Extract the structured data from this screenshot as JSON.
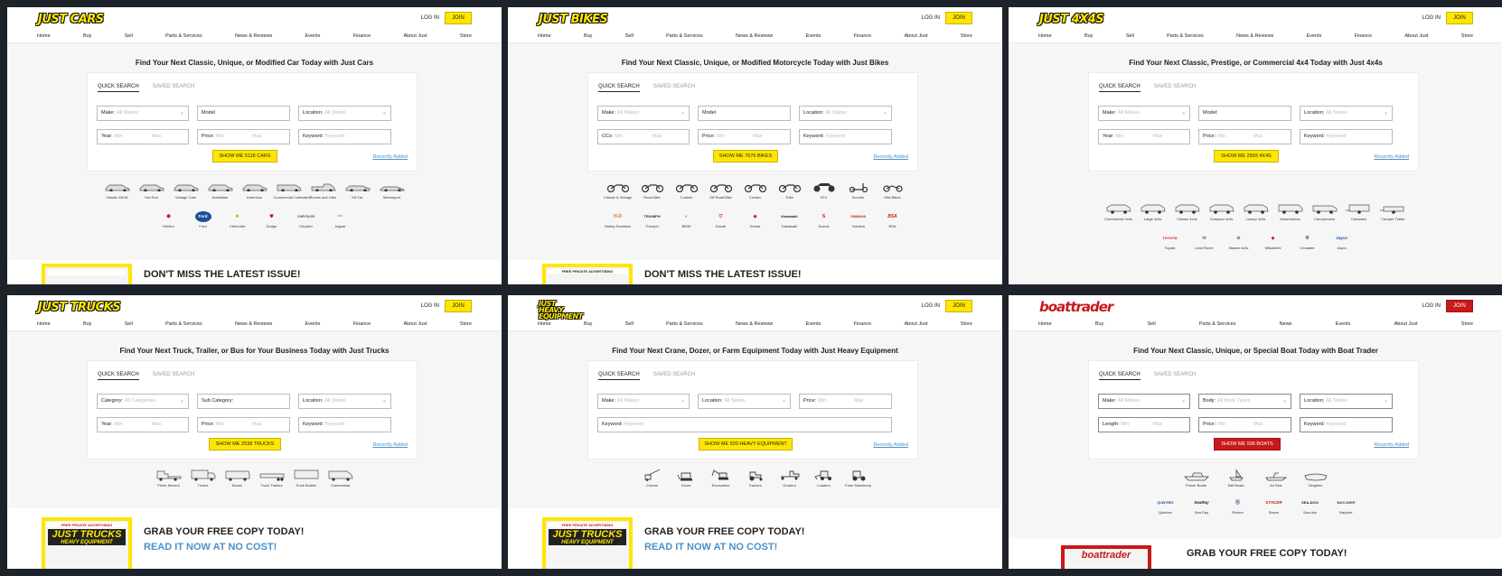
{
  "panels": [
    {
      "logo": "JUST CARS",
      "login": "LOG IN",
      "join": "JOIN",
      "nav": [
        "Home",
        "Buy",
        "Sell",
        "Parts & Services",
        "News & Reviews",
        "Events",
        "Finance",
        "About Just",
        "Store"
      ],
      "headline": "Find Your Next Classic, Unique, or Modified Car Today with Just Cars",
      "tabs": [
        "QUICK SEARCH",
        "SAVED SEARCH"
      ],
      "row1": [
        {
          "label": "Make:",
          "placeholder": "All Makes"
        },
        {
          "label": "Model",
          "placeholder": ""
        },
        {
          "label": "Location:",
          "placeholder": "All States"
        }
      ],
      "row2": [
        {
          "label": "Year:",
          "min": "Min",
          "max": "Max"
        },
        {
          "label": "Price:",
          "min": "Min",
          "max": "Max"
        },
        {
          "label": "Keyword:",
          "placeholder": "Keyword"
        }
      ],
      "cta": "SHOW ME 5118 CARS",
      "recent": "Recently Added",
      "categories": [
        "Classic 48-96",
        "Hot Rod",
        "Vintage Cars",
        "Australian",
        "American",
        "Commercial Collectable",
        "Trucks and Utes",
        "Kit Car",
        "Motorsport"
      ],
      "brands": [
        {
          "name": "Holden",
          "mark": "⬢"
        },
        {
          "name": "Ford",
          "mark": "Ford"
        },
        {
          "name": "Chevrolet",
          "mark": "✚"
        },
        {
          "name": "Dodge",
          "mark": "⛊"
        },
        {
          "name": "Chrysler",
          "mark": "CHRYSLER"
        },
        {
          "name": "Jaguar",
          "mark": "〰"
        }
      ],
      "promo_title": "DON'T MISS THE LATEST ISSUE!"
    },
    {
      "logo": "JUST BIKES",
      "login": "LOG IN",
      "join": "JOIN",
      "nav": [
        "Home",
        "Buy",
        "Sell",
        "Parts & Services",
        "News & Reviews",
        "Events",
        "Finance",
        "About Just",
        "Store"
      ],
      "headline": "Find Your Next Classic, Unique, or Modified Motorcycle Today with Just Bikes",
      "tabs": [
        "QUICK SEARCH",
        "SAVED SEARCH"
      ],
      "row1": [
        {
          "label": "Make:",
          "placeholder": "All Makes"
        },
        {
          "label": "Model",
          "placeholder": ""
        },
        {
          "label": "Location:",
          "placeholder": "All States"
        }
      ],
      "row2": [
        {
          "label": "CCs:",
          "min": "Min",
          "max": "Max"
        },
        {
          "label": "Price:",
          "min": "Min",
          "max": "Max"
        },
        {
          "label": "Keyword:",
          "placeholder": "Keyword"
        }
      ],
      "cta": "SHOW ME 7076 BIKES",
      "recent": "Recently Added",
      "categories": [
        "Classic & Vintage",
        "Road Bike",
        "Custom",
        "Off Road Bike",
        "Cruiser",
        "Trike",
        "ATV",
        "Scooter",
        "Mini Bikes"
      ],
      "brands": [
        {
          "name": "Harley-Davidson",
          "mark": "H-D"
        },
        {
          "name": "Triumph",
          "mark": "TRIUMPH"
        },
        {
          "name": "BMW",
          "mark": "◐"
        },
        {
          "name": "Ducati",
          "mark": "⛉"
        },
        {
          "name": "Honda",
          "mark": "◆"
        },
        {
          "name": "Kawasaki",
          "mark": "Kawasaki"
        },
        {
          "name": "Suzuki",
          "mark": "S"
        },
        {
          "name": "Yamaha",
          "mark": "YAMAHA"
        },
        {
          "name": "BSA",
          "mark": "BSA"
        }
      ],
      "promo_title": "DON'T MISS THE LATEST ISSUE!",
      "mag_banner": "FREE PRIVATE ADVERTISING"
    },
    {
      "logo": "JUST 4X4S",
      "login": "LOG IN",
      "join": "JOIN",
      "nav": [
        "Home",
        "Buy",
        "Sell",
        "Parts & Services",
        "News & Reviews",
        "Events",
        "Finance",
        "About Just",
        "Store"
      ],
      "headline": "Find Your Next Classic, Prestige, or Commercial 4x4 Today with Just 4x4s",
      "tabs": [
        "QUICK SEARCH",
        "SAVED SEARCH"
      ],
      "row1": [
        {
          "label": "Make:",
          "placeholder": "All Makes"
        },
        {
          "label": "Model:",
          "placeholder": ""
        },
        {
          "label": "Location:",
          "placeholder": "All States"
        }
      ],
      "row2": [
        {
          "label": "Year:",
          "min": "Min",
          "max": "Max"
        },
        {
          "label": "Price:",
          "min": "Min",
          "max": "Max"
        },
        {
          "label": "Keyword:",
          "placeholder": "Keyword"
        }
      ],
      "cta": "SHOW ME 2993 4X4S",
      "recent": "Recently Added",
      "categories": [
        "Commercial 4x4s",
        "Large 4x4s",
        "Classic 4x4s",
        "Compact 4x4s",
        "Luxury 4x4s",
        "Motorhomes",
        "Campervans",
        "Caravans",
        "Camper Trailer"
      ],
      "brands": [
        {
          "name": "Toyota",
          "mark": "TOYOTA"
        },
        {
          "name": "Land Rover",
          "mark": "⬭"
        },
        {
          "name": "Nissan 4x4s",
          "mark": "⊖"
        },
        {
          "name": "Mitsubishi",
          "mark": "◈"
        },
        {
          "name": "Crusader",
          "mark": "⛨"
        },
        {
          "name": "Jayco",
          "mark": "Jayco"
        }
      ]
    },
    {
      "logo": "JUST TRUCKS",
      "login": "LOG IN",
      "join": "JOIN",
      "nav": [
        "Home",
        "Buy",
        "Sell",
        "Parts & Services",
        "News & Reviews",
        "Events",
        "Finance",
        "About Just",
        "Store"
      ],
      "headline": "Find Your Next Truck, Trailer, or Bus for Your Business Today with Just Trucks",
      "tabs": [
        "QUICK SEARCH",
        "SAVED SEARCH"
      ],
      "row1": [
        {
          "label": "Category:",
          "placeholder": "All Categories"
        },
        {
          "label": "Sub Category:",
          "placeholder": ""
        },
        {
          "label": "Location:",
          "placeholder": "All States"
        }
      ],
      "row2": [
        {
          "label": "Year:",
          "min": "Min",
          "max": "Max"
        },
        {
          "label": "Price:",
          "min": "Min",
          "max": "Max"
        },
        {
          "label": "Keyword:",
          "placeholder": "Keyword"
        }
      ],
      "cta": "SHOW ME 2538 TRUCKS",
      "recent": "Recently Added",
      "categories": [
        "Prime Movers",
        "Trucks",
        "Buses",
        "Truck Trailers",
        "Truck Bodies",
        "Commercial"
      ],
      "promo_title": "GRAB YOUR FREE COPY TODAY!",
      "promo_link": "READ IT NOW AT NO COST!",
      "mag_banner": "FREE PRIVATE ADVERTISING",
      "mag_logo": "JUST TRUCKS",
      "mag_sub": "HEAVY EQUIPMENT"
    },
    {
      "logo": "JUST HEAVY EQUIPMENT",
      "login": "LOG IN",
      "join": "JOIN",
      "nav": [
        "Home",
        "Buy",
        "Sell",
        "Parts & Services",
        "News & Reviews",
        "Events",
        "Finance",
        "About Just",
        "Store"
      ],
      "headline": "Find Your Next Crane, Dozer, or Farm Equipment Today with Just Heavy Equipment",
      "tabs": [
        "QUICK SEARCH",
        "SAVED SEARCH"
      ],
      "row1": [
        {
          "label": "Make:",
          "placeholder": "All Makes"
        },
        {
          "label": "Location:",
          "placeholder": "All States"
        },
        {
          "label": "Price:",
          "min": "Min",
          "max": "Max"
        }
      ],
      "row2": [
        {
          "label": "Keyword:",
          "placeholder": "Keyword"
        }
      ],
      "cta": "SHOW ME 920 HEAVY EQUIPMENT",
      "recent": "Recently Added",
      "categories": [
        "Cranes",
        "Dozer",
        "Excavators",
        "Tractors",
        "Graders",
        "Loaders",
        "Farm Machinery"
      ],
      "promo_title": "GRAB YOUR FREE COPY TODAY!",
      "promo_link": "READ IT NOW AT NO COST!",
      "mag_banner": "FREE PRIVATE ADVERTISING",
      "mag_logo": "JUST TRUCKS",
      "mag_sub": "HEAVY EQUIPMENT"
    },
    {
      "logo": "boattrader",
      "login": "LOG IN",
      "join": "JOIN",
      "nav": [
        "Home",
        "Buy",
        "Sell",
        "Parts & Services",
        "News",
        "Events",
        "About Just",
        "Store"
      ],
      "headline": "Find Your Next Classic, Unique, or Special Boat Today with Boat Trader",
      "tabs": [
        "QUICK SEARCH",
        "SAVED SEARCH"
      ],
      "row1": [
        {
          "label": "Make:",
          "placeholder": "All Makes"
        },
        {
          "label": "Body:",
          "placeholder": "All Body Types"
        },
        {
          "label": "Location:",
          "placeholder": "All States"
        }
      ],
      "row2": [
        {
          "label": "Length:",
          "min": "Min",
          "max": "Max"
        },
        {
          "label": "Price:",
          "min": "Min",
          "max": "Max"
        },
        {
          "label": "Keyword:",
          "placeholder": "Keyword"
        }
      ],
      "cta": "SHOW ME 936 BOATS",
      "recent": "Recently Added",
      "categories": [
        "Power Boats",
        "Sail Boats",
        "Jet Skis",
        "Dinghies"
      ],
      "brands": [
        {
          "name": "Quintrex",
          "mark": "QUINTREX"
        },
        {
          "name": "Sea Ray",
          "mark": "SeaRay"
        },
        {
          "name": "Riviera",
          "mark": "Ⓡ"
        },
        {
          "name": "Stacer",
          "mark": "STACER"
        },
        {
          "name": "Sea-doo",
          "mark": "SEA-DOO"
        },
        {
          "name": "Bayliner",
          "mark": "BAYLINER"
        }
      ],
      "promo_title": "GRAB YOUR FREE COPY TODAY!",
      "mag_logo": "boattrader"
    }
  ],
  "colors": {
    "brand_yellow": "#ffe600",
    "boat_red": "#c8191b",
    "link_blue": "#4a90c8"
  }
}
